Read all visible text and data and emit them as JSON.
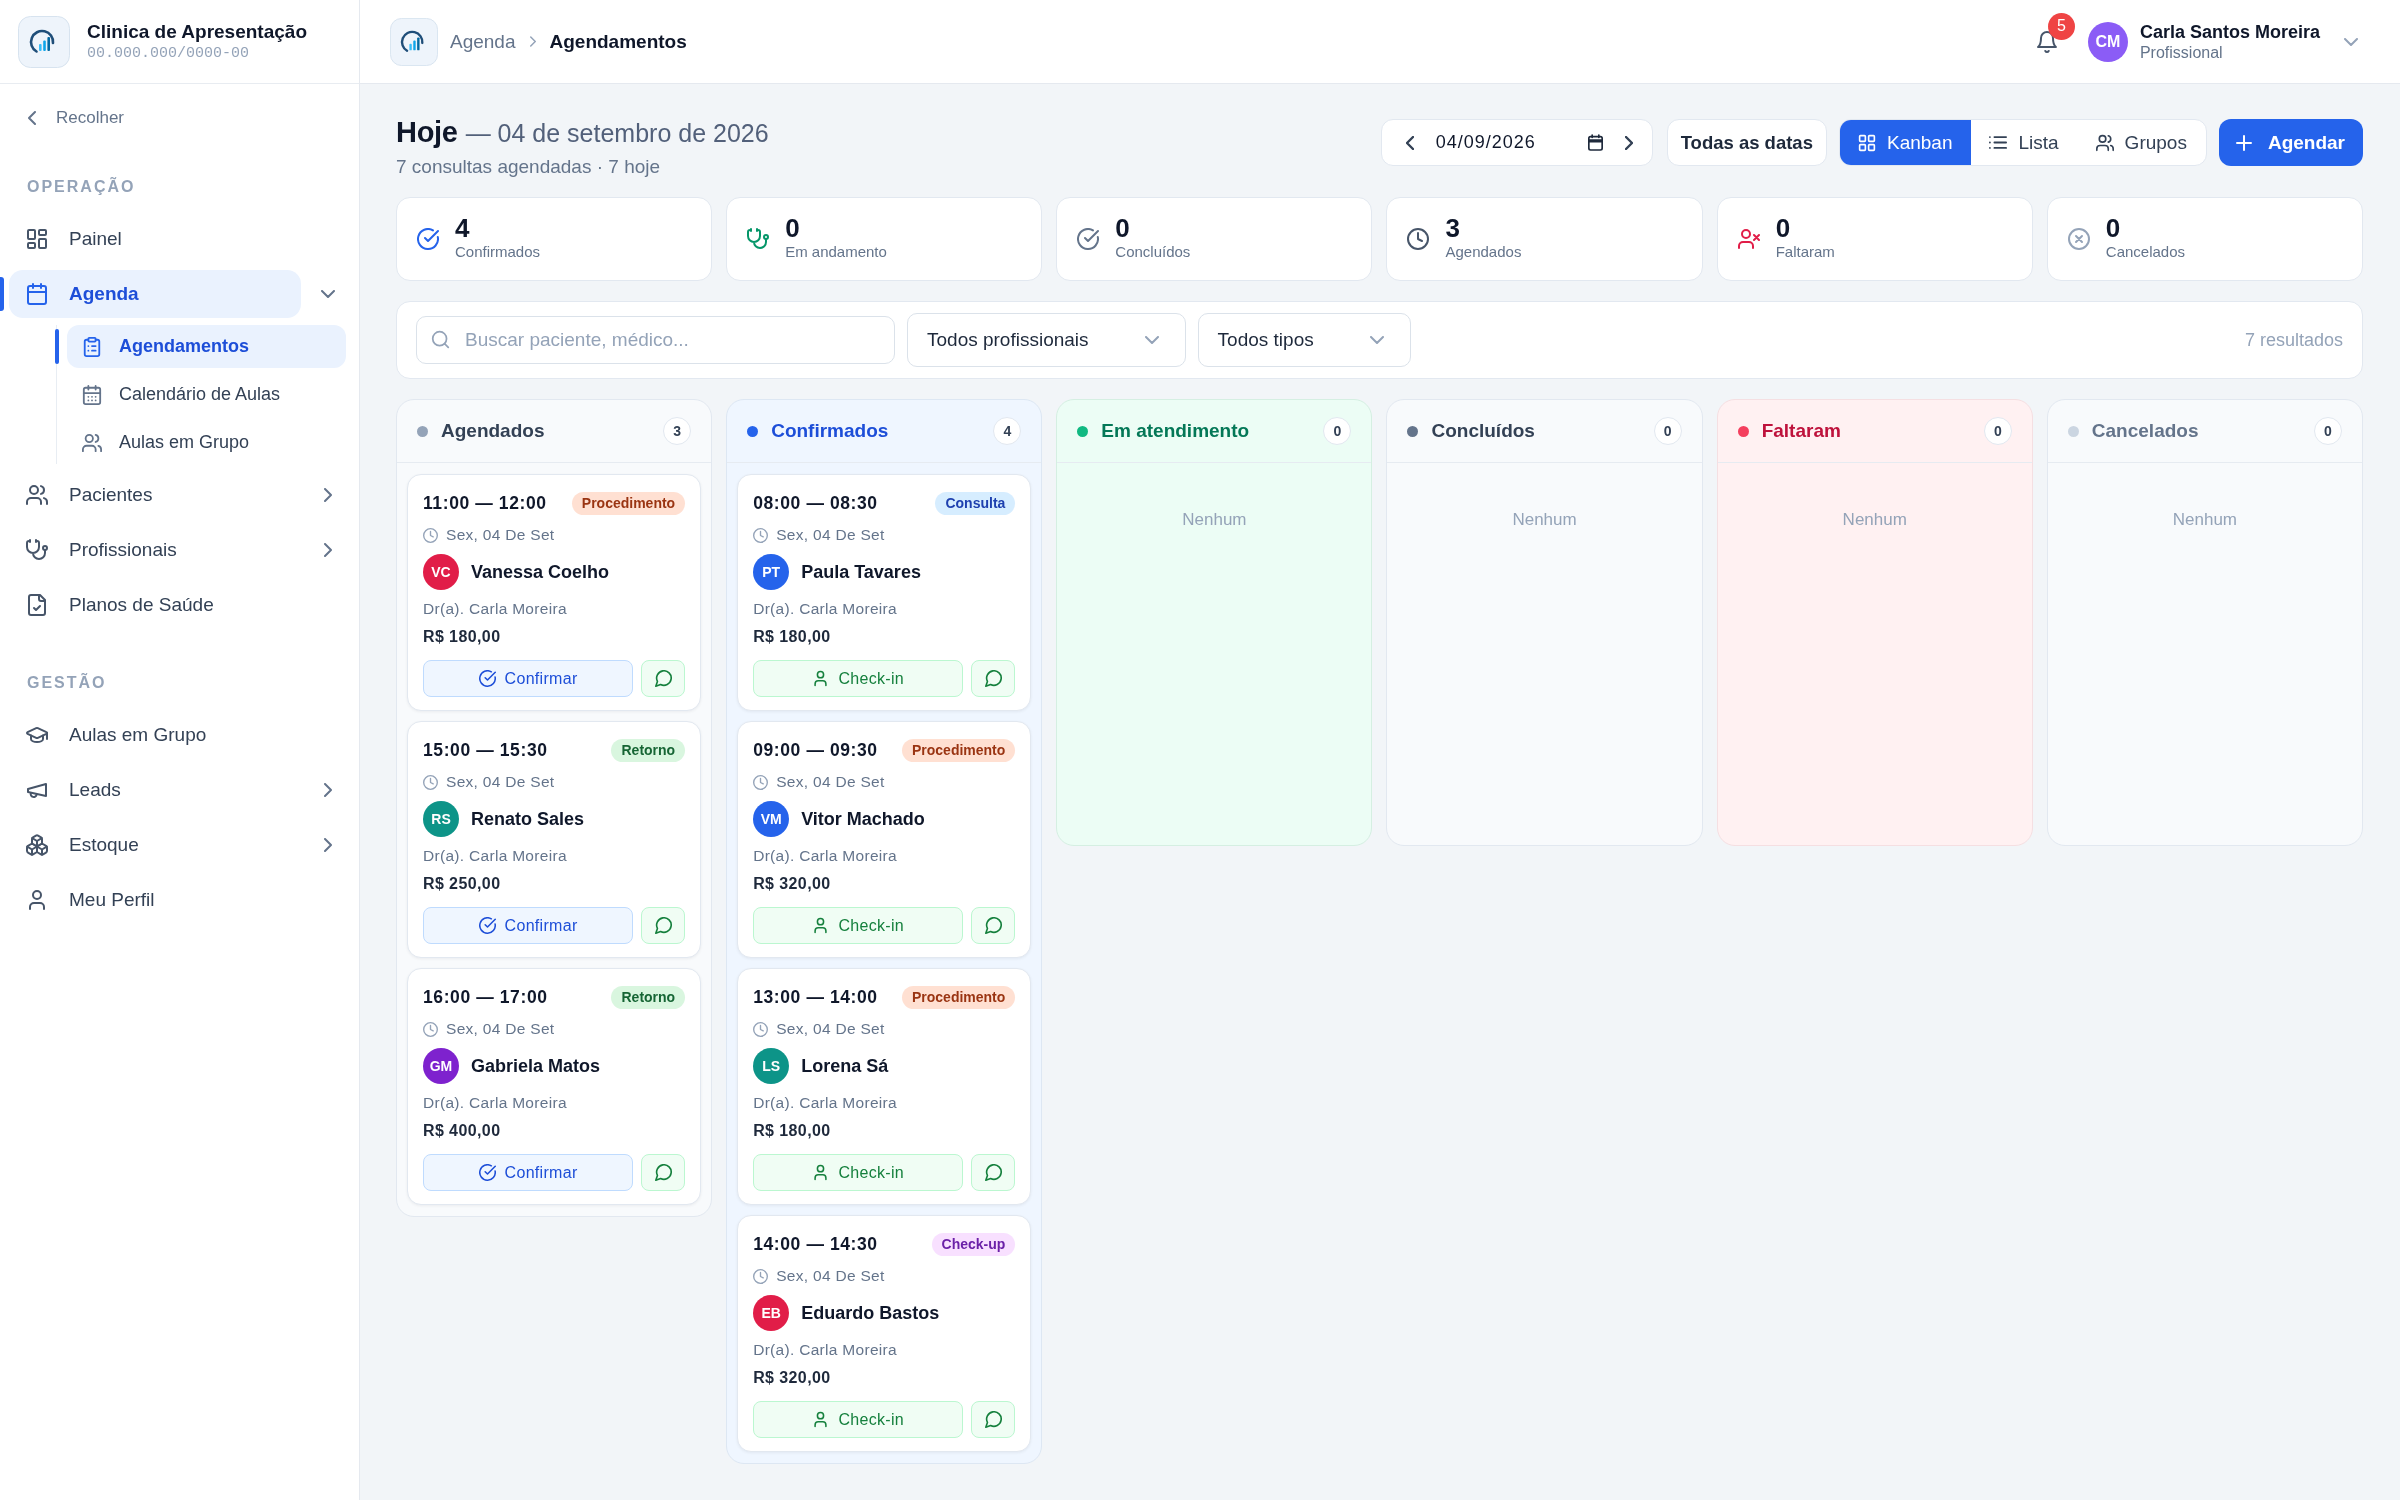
{
  "sidebar": {
    "clinic": {
      "name": "Clinica de Apresentação",
      "document": "00.000.000/0000-00"
    },
    "collapse_label": "Recolher",
    "sections": [
      {
        "label": "OPERAÇÃO",
        "items": [
          {
            "label": "Painel",
            "selected": false
          },
          {
            "label": "Agenda",
            "selected": true,
            "expanded": true,
            "children": [
              {
                "label": "Agendamentos",
                "selected": true
              },
              {
                "label": "Calendário de Aulas",
                "selected": false
              },
              {
                "label": "Aulas em Grupo",
                "selected": false
              }
            ]
          },
          {
            "label": "Pacientes",
            "selected": false,
            "expanded": false
          },
          {
            "label": "Profissionais",
            "selected": false,
            "expanded": false
          },
          {
            "label": "Planos de Saúde",
            "selected": false
          }
        ]
      },
      {
        "label": "GESTÃO",
        "items": [
          {
            "label": "Aulas em Grupo",
            "selected": false
          },
          {
            "label": "Leads",
            "selected": false,
            "expanded": false
          },
          {
            "label": "Estoque",
            "selected": false,
            "expanded": false
          },
          {
            "label": "Meu Perfil",
            "selected": false
          }
        ]
      }
    ]
  },
  "top_bar": {
    "breadcrumb": [
      "Agenda",
      "Agendamentos"
    ],
    "notifications": "5",
    "user": {
      "initials": "CM",
      "name": "Carla Santos Moreira",
      "role": "Profissional"
    }
  },
  "page_header": {
    "title": "Hoje",
    "date": "— 04 de setembro de 2026",
    "subtitle": "7 consultas agendadas · 7 hoje"
  },
  "toolbar": {
    "date_value": "04/09/2026",
    "all_dates_button": "Todas as datas",
    "view_tabs": [
      {
        "label": "Kanban",
        "selected": true
      },
      {
        "label": "Lista",
        "selected": false
      },
      {
        "label": "Grupos",
        "selected": false
      }
    ],
    "primary_button": "Agendar"
  },
  "stats": [
    {
      "kind": "confirmed",
      "value": "4",
      "label": "Confirmados"
    },
    {
      "kind": "in_progress",
      "value": "0",
      "label": "Em andamento"
    },
    {
      "kind": "done",
      "value": "0",
      "label": "Concluídos"
    },
    {
      "kind": "scheduled",
      "value": "3",
      "label": "Agendados"
    },
    {
      "kind": "missed",
      "value": "0",
      "label": "Faltaram"
    },
    {
      "kind": "cancelled",
      "value": "0",
      "label": "Cancelados"
    }
  ],
  "filters": {
    "search": {
      "placeholder": "Buscar paciente, médico..."
    },
    "dropdowns": [
      "Todos profissionais",
      "Todos tipos"
    ],
    "result_count": "7 resultados"
  },
  "columns": [
    {
      "kind": "scheduled",
      "title": "Agendados",
      "count": "3",
      "color": "#94a3b8",
      "cards": [
        {
          "time": "11:00 — 12:00",
          "tag": {
            "label": "Procedimento",
            "color": "#9a3412"
          },
          "date": "Sex, 04 De Set",
          "avatar": {
            "initials": "VC",
            "color": "#e11d48"
          },
          "patient": "Vanessa Coelho",
          "doctor": "Dr(a). Carla Moreira",
          "price": "R$ 180,00",
          "action": {
            "kind": "confirm",
            "label": "Confirmar"
          }
        },
        {
          "time": "15:00 — 15:30",
          "tag": {
            "label": "Retorno",
            "color": "#166534"
          },
          "date": "Sex, 04 De Set",
          "avatar": {
            "initials": "RS",
            "color": "#0d9488"
          },
          "patient": "Renato Sales",
          "doctor": "Dr(a). Carla Moreira",
          "price": "R$ 250,00",
          "action": {
            "kind": "confirm",
            "label": "Confirmar"
          }
        },
        {
          "time": "16:00 — 17:00",
          "tag": {
            "label": "Retorno",
            "color": "#166534"
          },
          "date": "Sex, 04 De Set",
          "avatar": {
            "initials": "GM",
            "color": "#7e22ce"
          },
          "patient": "Gabriela Matos",
          "doctor": "Dr(a). Carla Moreira",
          "price": "R$ 400,00",
          "action": {
            "kind": "confirm",
            "label": "Confirmar"
          }
        }
      ]
    },
    {
      "kind": "confirmed",
      "title": "Confirmados",
      "count": "4",
      "color": "#2563eb",
      "cards": [
        {
          "time": "08:00 — 08:30",
          "tag": {
            "label": "Consulta",
            "color": "#1e40af"
          },
          "date": "Sex, 04 De Set",
          "avatar": {
            "initials": "PT",
            "color": "#2563eb"
          },
          "patient": "Paula Tavares",
          "doctor": "Dr(a). Carla Moreira",
          "price": "R$ 180,00",
          "action": {
            "kind": "checkin",
            "label": "Check-in"
          }
        },
        {
          "time": "09:00 — 09:30",
          "tag": {
            "label": "Procedimento",
            "color": "#9a3412"
          },
          "date": "Sex, 04 De Set",
          "avatar": {
            "initials": "VM",
            "color": "#2563eb"
          },
          "patient": "Vitor Machado",
          "doctor": "Dr(a). Carla Moreira",
          "price": "R$ 320,00",
          "action": {
            "kind": "checkin",
            "label": "Check-in"
          }
        },
        {
          "time": "13:00 — 14:00",
          "tag": {
            "label": "Procedimento",
            "color": "#9a3412"
          },
          "date": "Sex, 04 De Set",
          "avatar": {
            "initials": "LS",
            "color": "#0d9488"
          },
          "patient": "Lorena Sá",
          "doctor": "Dr(a). Carla Moreira",
          "price": "R$ 180,00",
          "action": {
            "kind": "checkin",
            "label": "Check-in"
          }
        },
        {
          "time": "14:00 — 14:30",
          "tag": {
            "label": "Check-up",
            "color": "#6b21a8"
          },
          "date": "Sex, 04 De Set",
          "avatar": {
            "initials": "EB",
            "color": "#e11d48"
          },
          "patient": "Eduardo Bastos",
          "doctor": "Dr(a). Carla Moreira",
          "price": "R$ 320,00",
          "action": {
            "kind": "checkin",
            "label": "Check-in"
          }
        }
      ]
    },
    {
      "kind": "in_progress",
      "title": "Em atendimento",
      "count": "0",
      "color": "#10b981",
      "empty_text": "Nenhum"
    },
    {
      "kind": "done",
      "title": "Concluídos",
      "count": "0",
      "color": "#64748b",
      "empty_text": "Nenhum"
    },
    {
      "kind": "missed",
      "title": "Faltaram",
      "count": "0",
      "color": "#f43f5e",
      "empty_text": "Nenhum"
    },
    {
      "kind": "cancelled",
      "title": "Cancelados",
      "count": "0",
      "color": "#cbd5e1",
      "empty_text": "Nenhum"
    }
  ]
}
